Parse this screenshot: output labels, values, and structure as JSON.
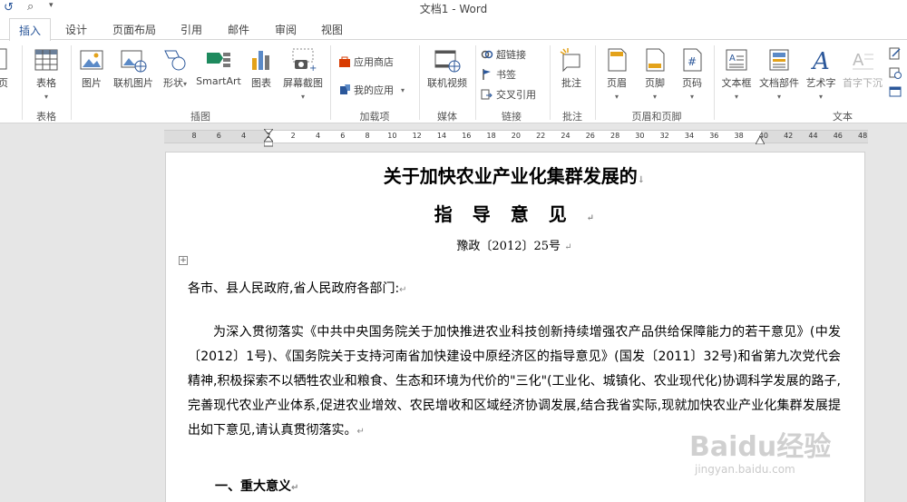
{
  "window": {
    "title": "文档1 - Word"
  },
  "tabs": [
    {
      "label": "插入",
      "active": true
    },
    {
      "label": "设计"
    },
    {
      "label": "页面布局"
    },
    {
      "label": "引用"
    },
    {
      "label": "邮件"
    },
    {
      "label": "审阅"
    },
    {
      "label": "视图"
    }
  ],
  "ribbon": {
    "pages_label": "页",
    "table": {
      "button": "表格",
      "group": "表格"
    },
    "illustrations": {
      "picture": "图片",
      "online_picture": "联机图片",
      "shapes": "形状",
      "smartart": "SmartArt",
      "chart": "图表",
      "screenshot": "屏幕截图",
      "group": "插图"
    },
    "addins": {
      "store": "应用商店",
      "my_apps": "我的应用",
      "group": "加载项"
    },
    "media": {
      "online_video": "联机视频",
      "group": "媒体"
    },
    "links": {
      "hyperlink": "超链接",
      "bookmark": "书签",
      "cross_ref": "交叉引用",
      "group": "链接"
    },
    "comments": {
      "comment": "批注",
      "group": "批注"
    },
    "header_footer": {
      "header": "页眉",
      "footer": "页脚",
      "page_number": "页码",
      "group": "页眉和页脚"
    },
    "text": {
      "text_box": "文本框",
      "quick_parts": "文档部件",
      "wordart": "艺术字",
      "drop_cap": "首字下沉",
      "group": "文本"
    }
  },
  "ruler": {
    "ticks": [
      "8",
      "6",
      "4",
      "2",
      "2",
      "4",
      "6",
      "8",
      "10",
      "12",
      "14",
      "16",
      "18",
      "20",
      "22",
      "24",
      "26",
      "28",
      "30",
      "32",
      "34",
      "36",
      "38",
      "40",
      "42",
      "44",
      "46",
      "48"
    ]
  },
  "document": {
    "title_line1": "关于加快农业产业化集群发展的",
    "title_line2": "指导意见",
    "doc_number": "豫政〔2012〕25号",
    "addressee": "各市、县人民政府,省人民政府各部门:",
    "paragraph": "为深入贯彻落实《中共中央国务院关于加快推进农业科技创新持续增强农产品供给保障能力的若干意见》(中发〔2012〕1号)、《国务院关于支持河南省加快建设中原经济区的指导意见》(国发〔2011〕32号)和省第九次党代会精神,积极探索不以牺牲农业和粮食、生态和环境为代价的\"三化\"(工业化、城镇化、农业现代化)协调科学发展的路子,完善现代农业产业体系,促进农业增效、农民增收和区域经济协调发展,结合我省实际,现就加快农业产业化集群发展提出如下意见,请认真贯彻落实。",
    "heading1": "一、重大意义"
  },
  "watermark": {
    "logo_text": "Baidu经验",
    "url": "jingyan.baidu.com"
  }
}
